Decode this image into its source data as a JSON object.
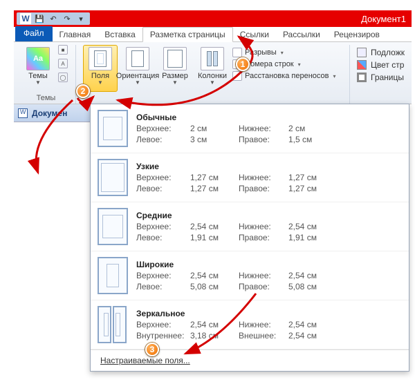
{
  "title_doc": "Документ1",
  "tabs": {
    "file": "Файл",
    "home": "Главная",
    "insert": "Вставка",
    "layout": "Разметка страницы",
    "refs": "Ссылки",
    "mail": "Рассылки",
    "review": "Рецензиров"
  },
  "qat_tips": {
    "w": "W",
    "save": "💾",
    "undo": "↶",
    "redo": "↷",
    "more": "▾"
  },
  "ribbon": {
    "themes": {
      "label": "Темы",
      "group": "Темы"
    },
    "margins": "Поля",
    "orientation": "Ориентация",
    "size": "Размер",
    "columns": "Колонки",
    "breaks": "Разрывы",
    "linenums": "Номера строк",
    "hyphen": "Расстановка переносов",
    "watermark": "Подложк",
    "pagecolor": "Цвет стр",
    "borders": "Границы"
  },
  "docpanel": "Докумен",
  "dd": {
    "labels_std": {
      "top": "Верхнее:",
      "bottom": "Нижнее:",
      "left": "Левое:",
      "right": "Правое:"
    },
    "labels_mirror": {
      "top": "Верхнее:",
      "bottom": "Нижнее:",
      "inner": "Внутреннее:",
      "outer": "Внешнее:"
    },
    "normal": {
      "title": "Обычные",
      "top": "2 см",
      "bottom": "2 см",
      "left": "3 см",
      "right": "1,5 см"
    },
    "narrow": {
      "title": "Узкие",
      "top": "1,27 см",
      "bottom": "1,27 см",
      "left": "1,27 см",
      "right": "1,27 см"
    },
    "moderate": {
      "title": "Средние",
      "top": "2,54 см",
      "bottom": "2,54 см",
      "left": "1,91 см",
      "right": "1,91 см"
    },
    "wide": {
      "title": "Широкие",
      "top": "2,54 см",
      "bottom": "2,54 см",
      "left": "5,08 см",
      "right": "5,08 см"
    },
    "mirror": {
      "title": "Зеркальное",
      "top": "2,54 см",
      "bottom": "2,54 см",
      "inner": "3,18 см",
      "outer": "2,54 см"
    },
    "custom": "Настраиваемые поля..."
  },
  "callouts": {
    "c1": "1",
    "c2": "2",
    "c3": "3"
  }
}
